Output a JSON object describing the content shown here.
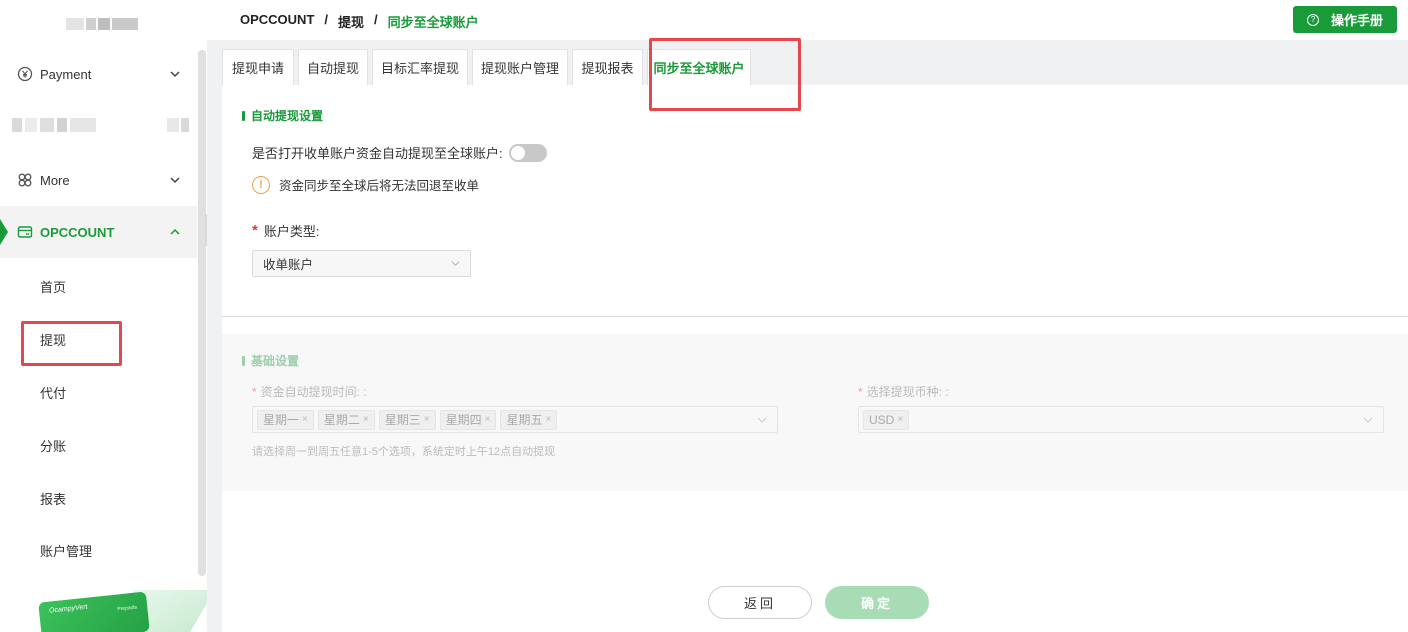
{
  "sidebar": {
    "menus": [
      {
        "label": "Payment",
        "icon": "yen-circle-icon"
      },
      {
        "label": "More",
        "icon": "grid-icon"
      },
      {
        "label": "OPCCOUNT",
        "icon": "card-icon"
      }
    ],
    "submenu": [
      "首页",
      "提现",
      "代付",
      "分账",
      "报表",
      "账户管理"
    ],
    "promo_card_text": "OcampyVert",
    "promo_card_small": "Prepaids"
  },
  "header": {
    "breadcrumbs": [
      "OPCCOUNT",
      "提现",
      "同步至全球账户"
    ],
    "separator": "/",
    "manual_button": "操作手册",
    "manual_icon": "?"
  },
  "tabs": [
    "提现申请",
    "自动提现",
    "目标汇率提现",
    "提现账户管理",
    "提现报表",
    "同步至全球账户"
  ],
  "auto_section": {
    "title": "自动提现设置",
    "toggle_label": "是否打开收单账户资金自动提现至全球账户:",
    "toggle_on": false,
    "warning_icon": "!",
    "warning": "资金同步至全球后将无法回退至收单",
    "required_mark": "*",
    "account_type_label": "账户类型:",
    "account_type_value": "收单账户"
  },
  "base_section": {
    "title": "基础设置",
    "time_label": "资金自动提现时间: :",
    "days": [
      "星期一",
      "星期二",
      "星期三",
      "星期四",
      "星期五"
    ],
    "currency_label": "选择提现币种: :",
    "currencies": [
      "USD"
    ],
    "chip_remove": "×",
    "hint": "请选择周一到周五任意1-5个选项，系统定时上午12点自动提现"
  },
  "footer": {
    "back_button": "返回",
    "confirm_button": "确定"
  },
  "colors": {
    "brand_green": "#1a9b3a",
    "highlight_red": "#e6474c"
  }
}
